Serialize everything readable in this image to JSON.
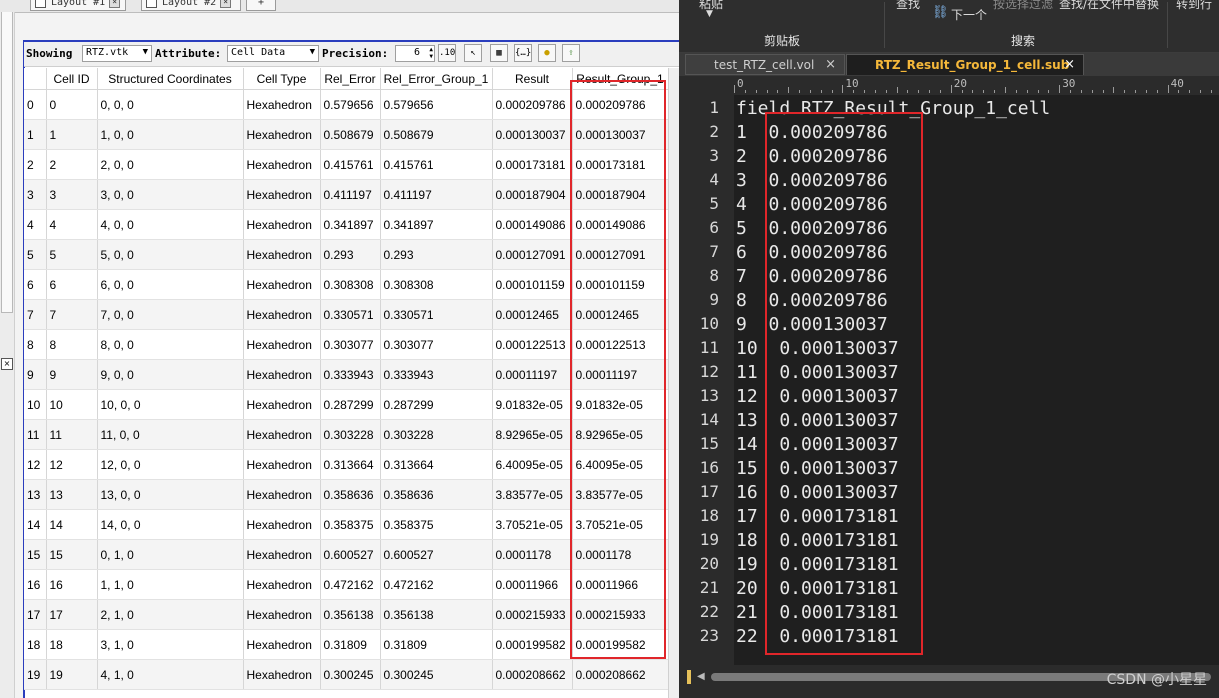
{
  "left": {
    "layout_tabs": [
      "Layout #1",
      "Layout #2"
    ],
    "add_tab": "+",
    "toolbar": {
      "showing_label": "Showing",
      "source": "RTZ.vtk",
      "attribute_label": "Attribute:",
      "attribute_value": "Cell Data",
      "precision_label": "Precision:",
      "precision_value": "6"
    },
    "columns": [
      "",
      "Cell ID",
      "Structured Coordinates",
      "Cell Type",
      "Rel_Error",
      "Rel_Error_Group_1",
      "Result",
      "Result_Group_1"
    ],
    "rows": [
      [
        "0",
        "0",
        "0, 0, 0",
        "Hexahedron",
        "0.579656",
        "0.579656",
        "0.000209786",
        "0.000209786"
      ],
      [
        "1",
        "1",
        "1, 0, 0",
        "Hexahedron",
        "0.508679",
        "0.508679",
        "0.000130037",
        "0.000130037"
      ],
      [
        "2",
        "2",
        "2, 0, 0",
        "Hexahedron",
        "0.415761",
        "0.415761",
        "0.000173181",
        "0.000173181"
      ],
      [
        "3",
        "3",
        "3, 0, 0",
        "Hexahedron",
        "0.411197",
        "0.411197",
        "0.000187904",
        "0.000187904"
      ],
      [
        "4",
        "4",
        "4, 0, 0",
        "Hexahedron",
        "0.341897",
        "0.341897",
        "0.000149086",
        "0.000149086"
      ],
      [
        "5",
        "5",
        "5, 0, 0",
        "Hexahedron",
        "0.293",
        "0.293",
        "0.000127091",
        "0.000127091"
      ],
      [
        "6",
        "6",
        "6, 0, 0",
        "Hexahedron",
        "0.308308",
        "0.308308",
        "0.000101159",
        "0.000101159"
      ],
      [
        "7",
        "7",
        "7, 0, 0",
        "Hexahedron",
        "0.330571",
        "0.330571",
        "0.00012465",
        "0.00012465"
      ],
      [
        "8",
        "8",
        "8, 0, 0",
        "Hexahedron",
        "0.303077",
        "0.303077",
        "0.000122513",
        "0.000122513"
      ],
      [
        "9",
        "9",
        "9, 0, 0",
        "Hexahedron",
        "0.333943",
        "0.333943",
        "0.00011197",
        "0.00011197"
      ],
      [
        "10",
        "10",
        "10, 0, 0",
        "Hexahedron",
        "0.287299",
        "0.287299",
        "9.01832e-05",
        "9.01832e-05"
      ],
      [
        "11",
        "11",
        "11, 0, 0",
        "Hexahedron",
        "0.303228",
        "0.303228",
        "8.92965e-05",
        "8.92965e-05"
      ],
      [
        "12",
        "12",
        "12, 0, 0",
        "Hexahedron",
        "0.313664",
        "0.313664",
        "6.40095e-05",
        "6.40095e-05"
      ],
      [
        "13",
        "13",
        "13, 0, 0",
        "Hexahedron",
        "0.358636",
        "0.358636",
        "3.83577e-05",
        "3.83577e-05"
      ],
      [
        "14",
        "14",
        "14, 0, 0",
        "Hexahedron",
        "0.358375",
        "0.358375",
        "3.70521e-05",
        "3.70521e-05"
      ],
      [
        "15",
        "15",
        "0, 1, 0",
        "Hexahedron",
        "0.600527",
        "0.600527",
        "0.0001178",
        "0.0001178"
      ],
      [
        "16",
        "16",
        "1, 1, 0",
        "Hexahedron",
        "0.472162",
        "0.472162",
        "0.00011966",
        "0.00011966"
      ],
      [
        "17",
        "17",
        "2, 1, 0",
        "Hexahedron",
        "0.356138",
        "0.356138",
        "0.000215933",
        "0.000215933"
      ],
      [
        "18",
        "18",
        "3, 1, 0",
        "Hexahedron",
        "0.31809",
        "0.31809",
        "0.000199582",
        "0.000199582"
      ],
      [
        "19",
        "19",
        "4, 1, 0",
        "Hexahedron",
        "0.300245",
        "0.300245",
        "0.000208662",
        "0.000208662"
      ]
    ]
  },
  "right": {
    "ribbon": {
      "paste": "粘贴",
      "find": "查找",
      "next": "下一个",
      "find_in_selection": "按选择过滤",
      "find_replace_in_files": "查找/在文件中替换",
      "goto_line": "转到行",
      "clipboard_group": "剪贴板",
      "search_group": "搜索"
    },
    "tabs": [
      {
        "label": "test_RTZ_cell.vol",
        "close": "×"
      },
      {
        "label": "RTZ_Result_Group_1_cell.sub",
        "close": "×"
      }
    ],
    "ruler": [
      "0",
      "10",
      "20",
      "30",
      "40"
    ],
    "lines": [
      {
        "num": "1",
        "text": "field RTZ_Result_Group_1_cell"
      },
      {
        "num": "2",
        "text": "1  0.000209786"
      },
      {
        "num": "3",
        "text": "2  0.000209786"
      },
      {
        "num": "4",
        "text": "3  0.000209786"
      },
      {
        "num": "5",
        "text": "4  0.000209786"
      },
      {
        "num": "6",
        "text": "5  0.000209786"
      },
      {
        "num": "7",
        "text": "6  0.000209786"
      },
      {
        "num": "8",
        "text": "7  0.000209786"
      },
      {
        "num": "9",
        "text": "8  0.000209786"
      },
      {
        "num": "10",
        "text": "9  0.000130037"
      },
      {
        "num": "11",
        "text": "10  0.000130037"
      },
      {
        "num": "12",
        "text": "11  0.000130037"
      },
      {
        "num": "13",
        "text": "12  0.000130037"
      },
      {
        "num": "14",
        "text": "13  0.000130037"
      },
      {
        "num": "15",
        "text": "14  0.000130037"
      },
      {
        "num": "16",
        "text": "15  0.000130037"
      },
      {
        "num": "17",
        "text": "16  0.000130037"
      },
      {
        "num": "18",
        "text": "17  0.000173181"
      },
      {
        "num": "19",
        "text": "18  0.000173181"
      },
      {
        "num": "20",
        "text": "19  0.000173181"
      },
      {
        "num": "21",
        "text": "20  0.000173181"
      },
      {
        "num": "22",
        "text": "21  0.000173181"
      },
      {
        "num": "23",
        "text": "22  0.000173181"
      }
    ],
    "watermark": "CSDN @小星星"
  },
  "colors": {
    "highlight_box": "#e0262a",
    "active_tab_text": "#f5b83a",
    "editor_bg": "#1f1f1f"
  }
}
